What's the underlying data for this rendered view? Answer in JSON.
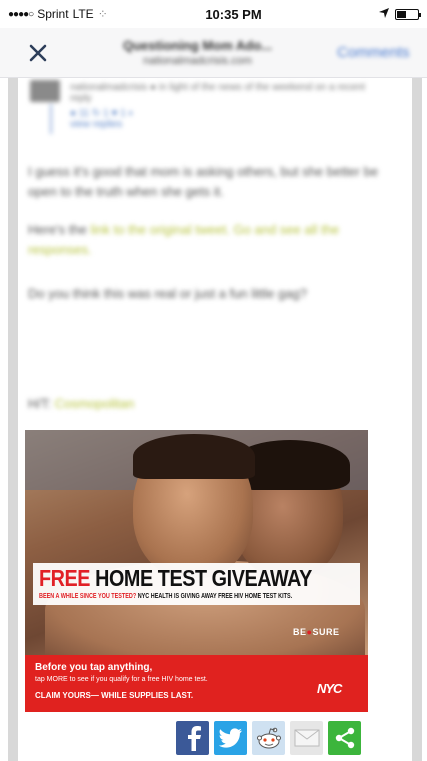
{
  "status_bar": {
    "carrier": "Sprint",
    "network": "LTE",
    "time": "10:35 PM"
  },
  "nav": {
    "title": "Questioning Mom Ado...",
    "subtitle": "nationalmadcrisis.com",
    "action": "Comments"
  },
  "comment": {
    "meta": "nationalmadcrisis ● in light of the news of the weekend on a recent reply",
    "stats": "● 11  ↻ 1    ♥ 1    ◐",
    "link": "view replies"
  },
  "article": {
    "p1": "I guess it's good that mom is asking others, but she better be open to the truth when she gets it.",
    "p2_text": "Here's the ",
    "p2_link": "link to the original tweet. Go and see all the responses.",
    "p3": "Do you think this was real or just a fun little gag?",
    "p4_text": "H/T: ",
    "p4_link": "Cosmopolitan"
  },
  "ad": {
    "headline_red": "FREE",
    "headline_rest": " HOME TEST GIVEAWAY",
    "subline_red": "BEEN A WHILE SINCE YOU TESTED?",
    "subline_rest": " NYC HEALTH IS GIVING AWAY FREE HIV HOME TEST KITS.",
    "bebrave_pre": "BE",
    "bebrave_mid": "SURE",
    "cta_line1": "Before you tap anything,",
    "cta_line2": "tap MORE to see if you qualify for a free HIV home test.",
    "cta_line3": "CLAIM YOURS— WHILE SUPPLIES LAST.",
    "logo": "NYC"
  },
  "colors": {
    "nyc_red": "#e0221f",
    "facebook": "#3b5998",
    "twitter": "#2aa3e6",
    "share_green": "#3cb53c",
    "nav_blue": "#4a7bd0"
  },
  "share_icons": [
    "facebook-icon",
    "twitter-icon",
    "reddit-icon",
    "email-icon",
    "share-icon"
  ]
}
